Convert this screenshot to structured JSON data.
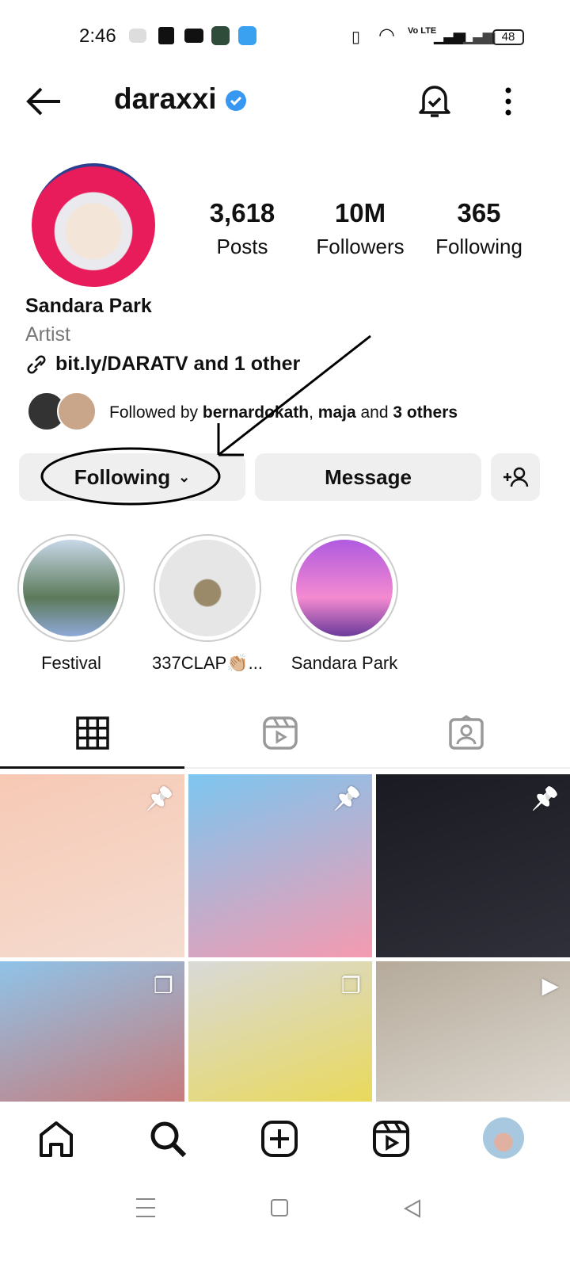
{
  "status_bar": {
    "time": "2:46",
    "battery": "48",
    "network": "Vo LTE"
  },
  "header": {
    "username": "daraxxi",
    "verified": true
  },
  "profile": {
    "name": "Sandara Park",
    "category": "Artist",
    "link": "bit.ly/DARATV and 1 other",
    "stats": [
      {
        "value": "3,618",
        "label": "Posts"
      },
      {
        "value": "10M",
        "label": "Followers"
      },
      {
        "value": "365",
        "label": "Following"
      }
    ],
    "followed_by": {
      "prefix": "Followed by ",
      "user1": "bernardokath",
      "sep": ", ",
      "user2": "maja",
      "suffix_and": " and ",
      "others": "3 others"
    }
  },
  "buttons": {
    "following": "Following",
    "message": "Message"
  },
  "highlights": [
    {
      "label": "Festival"
    },
    {
      "label": "337CLAP👏🏼..."
    },
    {
      "label": "Sandara Park"
    }
  ],
  "tabs": [
    "grid",
    "reels",
    "tagged"
  ],
  "grid": [
    {
      "type": "pinned",
      "colors": [
        "#f7c9b5",
        "#f4dcd0"
      ]
    },
    {
      "type": "pinned",
      "colors": [
        "#7cc6f0",
        "#f59ab0"
      ]
    },
    {
      "type": "pinned",
      "colors": [
        "#1a1a22",
        "#30303a"
      ]
    },
    {
      "type": "carousel",
      "colors": [
        "#8fc3e8",
        "#c77b7b"
      ]
    },
    {
      "type": "carousel",
      "colors": [
        "#d9d9d9",
        "#e9d95a"
      ]
    },
    {
      "type": "reel",
      "colors": [
        "#b5aa9a",
        "#ddd8d0"
      ]
    }
  ],
  "bottom_nav": [
    "home",
    "search",
    "create",
    "reels",
    "profile"
  ]
}
